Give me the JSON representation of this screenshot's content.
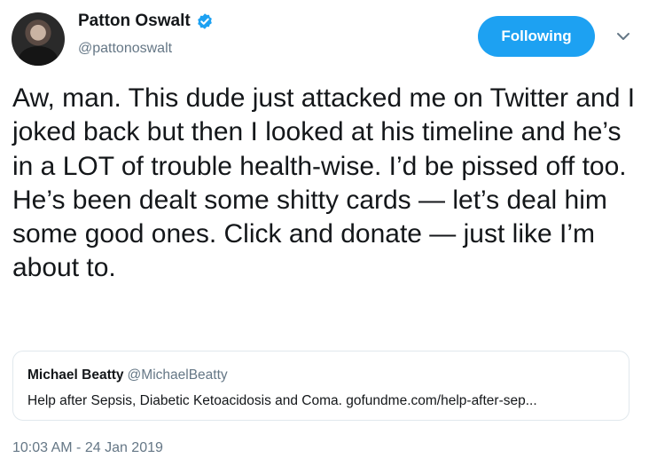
{
  "author": {
    "display_name": "Patton Oswalt",
    "handle": "@pattonoswalt",
    "avatar_icon": "avatar",
    "verified_icon": "verified-badge-icon"
  },
  "follow_button": {
    "label": "Following"
  },
  "menu_icon": "chevron-down-icon",
  "tweet": {
    "text": "Aw, man. This dude just attacked me on Twitter and I joked back but then I looked at his timeline and he’s in a LOT of trouble health-wise. I’d be pissed off too. He’s been dealt some shitty cards — let’s deal him some good ones. Click and donate — just like I’m about to."
  },
  "quote": {
    "name": "Michael Beatty",
    "handle": "@MichaelBeatty",
    "text": "Help after Sepsis, Diabetic Ketoacidosis and Coma. gofundme.com/help-after-sep..."
  },
  "timestamp": "10:03 AM - 24 Jan 2019",
  "colors": {
    "accent": "#1da1f2",
    "secondary_text": "#657786",
    "primary_text": "#14171a",
    "border": "#e1e8ed"
  }
}
